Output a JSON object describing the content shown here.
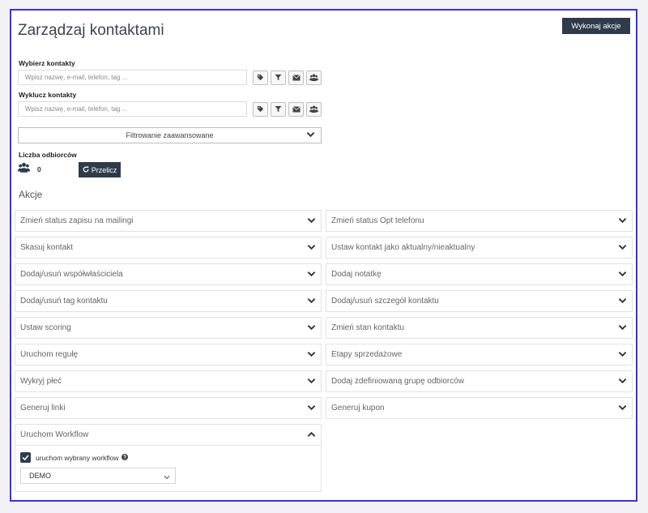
{
  "page": {
    "title": "Zarządzaj kontaktami",
    "run_actions_label": "Wykonaj akcje"
  },
  "include": {
    "label": "Wybierz kontakty",
    "placeholder": "Wpisz nazwę, e-mail, telefon, tag ..."
  },
  "exclude": {
    "label": "Wyklucz kontakty",
    "placeholder": "Wpisz nazwę, e-mail, telefon, tag ..."
  },
  "advanced_filter": {
    "label": "Filtrowanie zaawansowane"
  },
  "recipients": {
    "label": "Liczba odbiorców",
    "count": "0",
    "recalc_label": "Przelicz"
  },
  "actions": {
    "title": "Akcje",
    "left": [
      "Zmień status zapisu na mailingi",
      "Skasuj kontakt",
      "Dodaj/usuń współwłaściciela",
      "Dodaj/usuń tag kontaktu",
      "Ustaw scoring",
      "Uruchom regułę",
      "Wykryj płeć",
      "Generuj linki"
    ],
    "right": [
      "Zmień status Opt telefonu",
      "Ustaw kontakt jako aktualny/nieaktualny",
      "Dodaj notatkę",
      "Dodaj/usuń szczegół kontaktu",
      "Zmień stan kontaktu",
      "Etapy sprzedażowe",
      "Dodaj zdefiniowaną grupę odbiorców",
      "Generuj kupon"
    ],
    "workflow": {
      "title": "Uruchom Workflow",
      "checkbox_label": "uruchom wybrany workflow",
      "checked": true,
      "selected": "DEMO"
    }
  },
  "colors": {
    "dark_button": "#2f3b4a",
    "frame_border": "#3b32d6"
  }
}
